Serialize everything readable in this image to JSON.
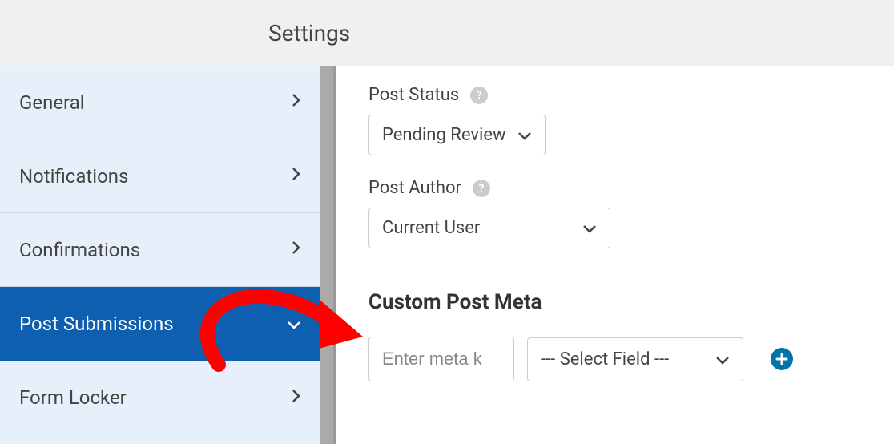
{
  "header": {
    "title": "Settings"
  },
  "sidebar": {
    "items": [
      {
        "label": "General"
      },
      {
        "label": "Notifications"
      },
      {
        "label": "Confirmations"
      },
      {
        "label": "Post Submissions"
      },
      {
        "label": "Form Locker"
      }
    ]
  },
  "main": {
    "post_status": {
      "label": "Post Status",
      "value": "Pending Review"
    },
    "post_author": {
      "label": "Post Author",
      "value": "Current User"
    },
    "custom_post_meta": {
      "heading": "Custom Post Meta",
      "meta_key_placeholder": "Enter meta k",
      "select_field_label": "--- Select Field ---"
    }
  }
}
